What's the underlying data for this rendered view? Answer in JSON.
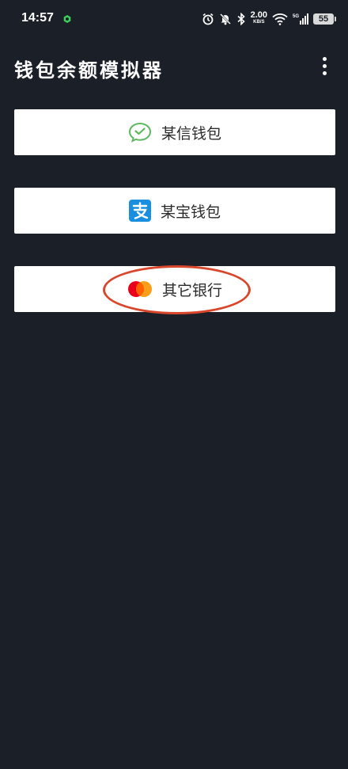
{
  "status_bar": {
    "time": "14:57",
    "speed_value": "2.00",
    "speed_unit": "KB/S",
    "network": "5G",
    "battery": "55"
  },
  "app_bar": {
    "title": "钱包余额模拟器"
  },
  "wallets": [
    {
      "label": "某信钱包",
      "icon": "wechat-icon",
      "color": "#5bb85d"
    },
    {
      "label": "某宝钱包",
      "icon": "alipay-icon",
      "color": "#1a8fe0"
    },
    {
      "label": "其它银行",
      "icon": "mastercard-icon",
      "color": "#eb001b"
    }
  ],
  "colors": {
    "background": "#1b1f27",
    "highlight": "#d8472c"
  }
}
